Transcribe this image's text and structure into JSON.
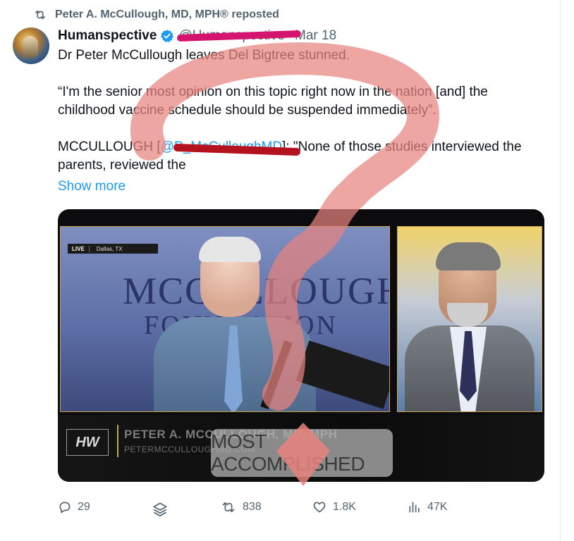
{
  "repost": {
    "text": "Peter A. McCullough, MD, MPH® reposted"
  },
  "tweet": {
    "display_name": "Humanspective",
    "handle": "@Humanspective",
    "separator": "·",
    "date": "Mar 18",
    "text_line1": "Dr Peter McCullough leaves Del Bigtree stunned.",
    "text_line2": "“I'm the senior most opinion on this topic right now in the nation [and] the childhood vaccine schedule should be suspended immediately”.",
    "text_line3_pre": "MCCULLOUGH [",
    "text_line3_mention": "@P_McCulloughMD",
    "text_line3_post": "]: \"None of those studies interviewed the parents, reviewed the",
    "show_more": "Show more"
  },
  "media": {
    "live_label": "LIVE",
    "live_location": "Dallas, TX",
    "bg_word1": "MCCULLOUGH",
    "bg_word2": "FOUNDATION",
    "logo_text": "HW",
    "lower_third_name": "PETER A. MCCULLOUGH, MD, MPH",
    "lower_third_site": "PETERMCCULLOUGHMD.COM",
    "caption": "MOST ACCOMPLISHED"
  },
  "actions": {
    "replies": "29",
    "reposts": "838",
    "likes": "1.8K",
    "views": "47K"
  },
  "colors": {
    "link": "#1d9bf0",
    "muted": "#536471",
    "verified": "#1d9bf0",
    "redaction_handle": "#d4146e",
    "redaction_mention": "#b3121e",
    "question_mark_overlay": "#e8837e"
  }
}
